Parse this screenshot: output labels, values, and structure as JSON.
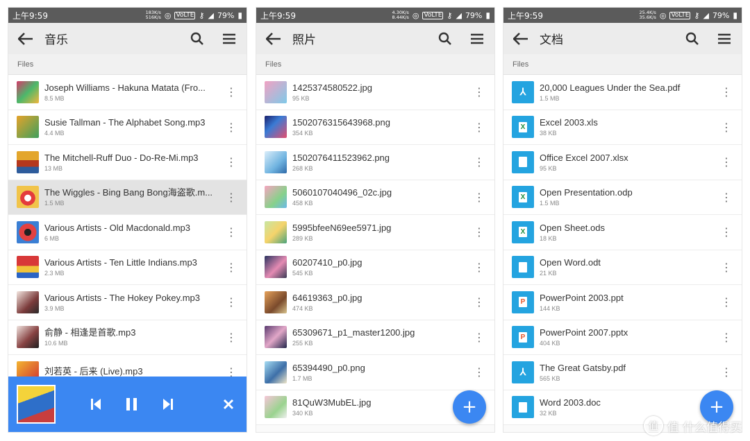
{
  "panels": [
    {
      "status": {
        "time": "上午9:59",
        "speed_up": "183K/s",
        "speed_down": "516K/s",
        "volte": "VoLTE",
        "net": "4G",
        "battery": "79%"
      },
      "appbar": {
        "title": "音乐",
        "back_icon": "arrow-left-icon",
        "search_icon": "search-icon",
        "menu_icon": "menu-icon"
      },
      "breadcrumb": "Files",
      "items": [
        {
          "name": "Joseph Williams - Hakuna Matata (Fro...",
          "size": "8.5 MB",
          "thumb": "album-cover"
        },
        {
          "name": "Susie Tallman - The Alphabet Song.mp3",
          "size": "4.4 MB",
          "thumb": "album-cover"
        },
        {
          "name": "The Mitchell-Ruff Duo - Do-Re-Mi.mp3",
          "size": "13 MB",
          "thumb": "album-cover"
        },
        {
          "name": "The Wiggles - Bing Bang Bong海盗歌.m...",
          "size": "1.5 MB",
          "thumb": "album-cover",
          "selected": true
        },
        {
          "name": "Various Artists - Old Macdonald.mp3",
          "size": "6 MB",
          "thumb": "album-cover"
        },
        {
          "name": "Various Artists - Ten Little Indians.mp3",
          "size": "2.3 MB",
          "thumb": "album-cover"
        },
        {
          "name": "Various Artists - The Hokey Pokey.mp3",
          "size": "3.9 MB",
          "thumb": "album-cover"
        },
        {
          "name": "俞静 - 相逢是首歌.mp3",
          "size": "10.6 MB",
          "thumb": "album-cover"
        },
        {
          "name": "刘若英 - 后来 (Live).mp3",
          "size": "",
          "thumb": "album-cover"
        }
      ],
      "player": {
        "prev_icon": "skip-previous-icon",
        "pause_icon": "pause-icon",
        "next_icon": "skip-next-icon",
        "close_icon": "close-icon"
      }
    },
    {
      "status": {
        "time": "上午9:59",
        "speed_up": "4.30K/s",
        "speed_down": "8.44K/s",
        "volte": "VoLTE",
        "net": "4G",
        "battery": "79%"
      },
      "appbar": {
        "title": "照片",
        "back_icon": "arrow-left-icon",
        "search_icon": "search-icon",
        "menu_icon": "menu-icon"
      },
      "breadcrumb": "Files",
      "items": [
        {
          "name": "1425374580522.jpg",
          "size": "95 KB"
        },
        {
          "name": "1502076315643968.png",
          "size": "354 KB"
        },
        {
          "name": "1502076411523962.png",
          "size": "268 KB"
        },
        {
          "name": "5060107040496_02c.jpg",
          "size": "458 KB"
        },
        {
          "name": "5995bfeeN69ee5971.jpg",
          "size": "289 KB"
        },
        {
          "name": "60207410_p0.jpg",
          "size": "545 KB"
        },
        {
          "name": "64619363_p0.jpg",
          "size": "474 KB"
        },
        {
          "name": "65309671_p1_master1200.jpg",
          "size": "255 KB"
        },
        {
          "name": "65394490_p0.png",
          "size": "1.7 MB"
        },
        {
          "name": "81QuW3MubEL.jpg",
          "size": "340 KB"
        }
      ],
      "fab": {
        "label": "+",
        "icon": "add-icon"
      }
    },
    {
      "status": {
        "time": "上午9:59",
        "speed_up": "25.4K/s",
        "speed_down": "35.6K/s",
        "volte": "VoLTE",
        "net": "4G",
        "battery": "79%"
      },
      "appbar": {
        "title": "文档",
        "back_icon": "arrow-left-icon",
        "search_icon": "search-icon",
        "menu_icon": "menu-icon"
      },
      "breadcrumb": "Files",
      "items": [
        {
          "name": "20,000 Leagues Under the Sea.pdf",
          "size": "1.5 MB",
          "type": "pdf"
        },
        {
          "name": "Excel 2003.xls",
          "size": "38 KB",
          "type": "xls"
        },
        {
          "name": "Office Excel 2007.xlsx",
          "size": "95 KB",
          "type": "doc"
        },
        {
          "name": "Open Presentation.odp",
          "size": "1.5 MB",
          "type": "xls"
        },
        {
          "name": "Open Sheet.ods",
          "size": "18 KB",
          "type": "xls"
        },
        {
          "name": "Open Word.odt",
          "size": "21 KB",
          "type": "doc"
        },
        {
          "name": "PowerPoint 2003.ppt",
          "size": "144 KB",
          "type": "ppt"
        },
        {
          "name": "PowerPoint 2007.pptx",
          "size": "404 KB",
          "type": "ppt"
        },
        {
          "name": "The Great Gatsby.pdf",
          "size": "565 KB",
          "type": "pdf"
        },
        {
          "name": "Word 2003.doc",
          "size": "32 KB",
          "type": "doc"
        }
      ],
      "fab": {
        "label": "+",
        "icon": "add-icon"
      }
    }
  ],
  "watermark": {
    "text": "值 什么值得买",
    "icon": "site-logo-icon"
  }
}
